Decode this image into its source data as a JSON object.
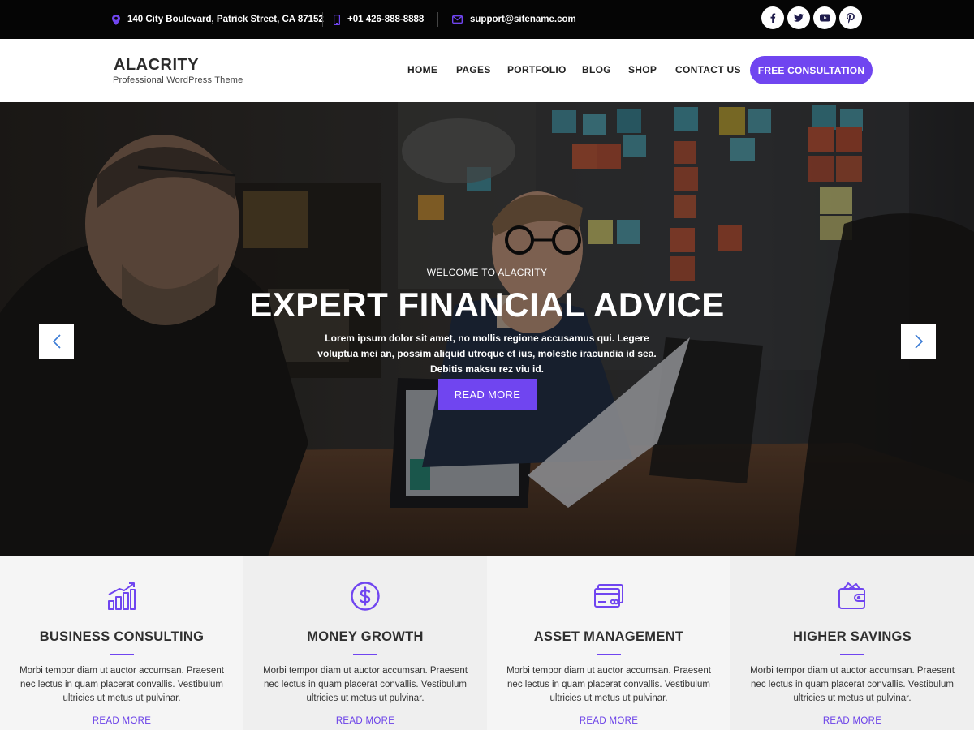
{
  "topbar": {
    "address": "140 City Boulevard, Patrick Street, CA 87152",
    "phone": "+01 426-888-8888",
    "email": "support@sitename.com",
    "socials": [
      "facebook-icon",
      "twitter-icon",
      "youtube-icon",
      "pinterest-icon"
    ]
  },
  "header": {
    "site_title": "ALACRITY",
    "tagline": "Professional WordPress Theme",
    "nav": [
      "HOME",
      "PAGES",
      "PORTFOLIO",
      "BLOG",
      "SHOP",
      "CONTACT US"
    ],
    "cta": "FREE CONSULTATION"
  },
  "hero": {
    "kicker": "WELCOME TO ALACRITY",
    "title": "EXPERT FINANCIAL ADVICE",
    "description": "Lorem ipsum dolor sit amet, no mollis regione accusamus qui. Legere voluptua mei an, possim aliquid utroque et ius, molestie iracundia id sea. Debitis maksu rez viu id.",
    "button": "READ MORE"
  },
  "features": [
    {
      "icon": "growth-chart-icon",
      "title": "BUSINESS CONSULTING",
      "text": "Morbi tempor diam ut auctor accumsan. Praesent nec lectus in quam placerat convallis. Vestibulum ultricies ut metus ut pulvinar.",
      "link": "READ MORE"
    },
    {
      "icon": "dollar-coin-icon",
      "title": "MONEY GROWTH",
      "text": "Morbi tempor diam ut auctor accumsan. Praesent nec lectus in quam placerat convallis. Vestibulum ultricies ut metus ut pulvinar.",
      "link": "READ MORE"
    },
    {
      "icon": "credit-card-icon",
      "title": "ASSET MANAGEMENT",
      "text": "Morbi tempor diam ut auctor accumsan. Praesent nec lectus in quam placerat convallis. Vestibulum ultricies ut metus ut pulvinar.",
      "link": "READ MORE"
    },
    {
      "icon": "wallet-icon",
      "title": "HIGHER SAVINGS",
      "text": "Morbi tempor diam ut auctor accumsan. Praesent nec lectus in quam placerat convallis. Vestibulum ultricies ut metus ut pulvinar.",
      "link": "READ MORE"
    }
  ],
  "colors": {
    "accent": "#7045f0",
    "topbar_bg": "#050505"
  }
}
